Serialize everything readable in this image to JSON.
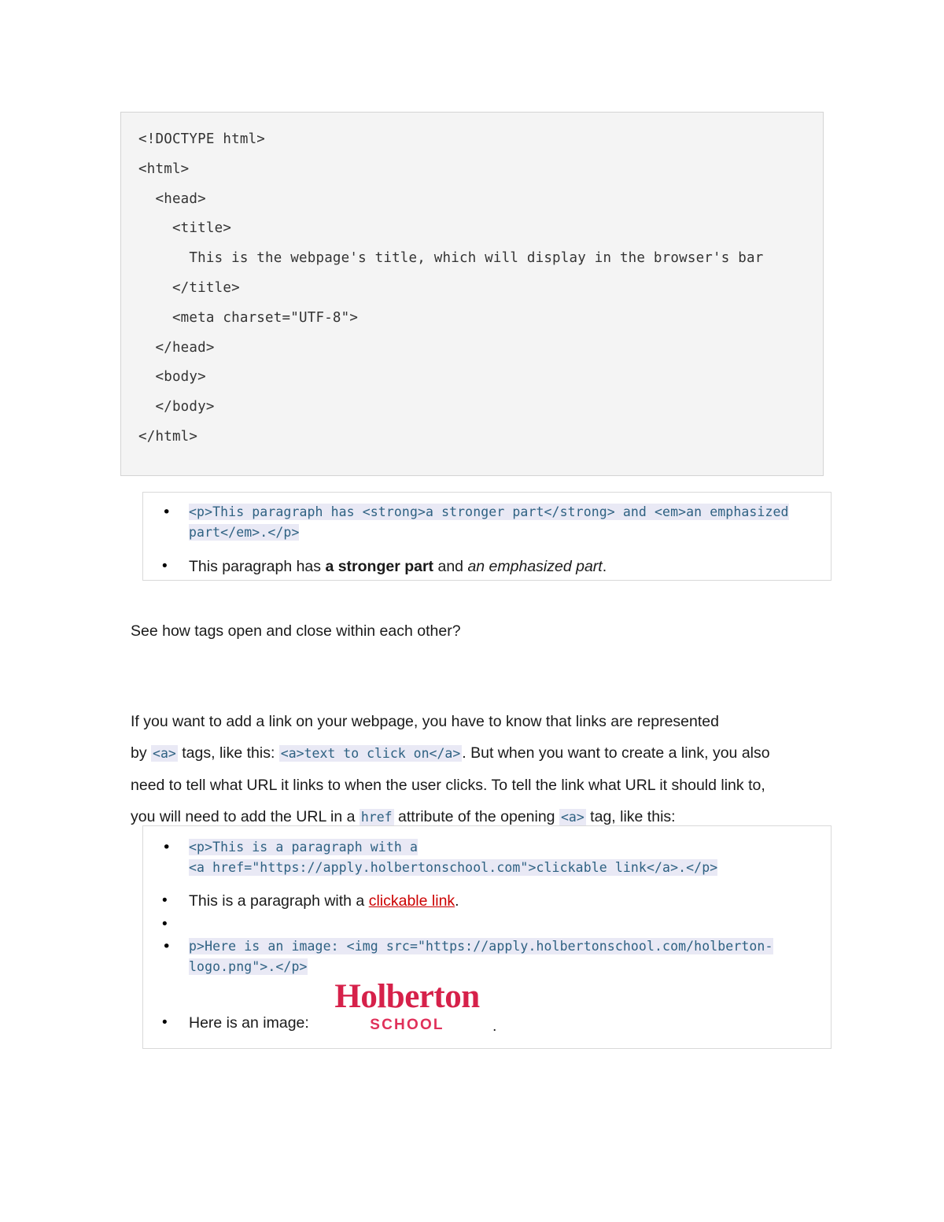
{
  "document": {
    "code_block": {
      "name": "html-skeleton-code",
      "lines": [
        "<!DOCTYPE html>",
        "<html>",
        "  <head>",
        "    <title>",
        "      This is the webpage's title, which will display in the browser's bar",
        "    </title>",
        "    <meta charset=\"UTF-8\">",
        "  </head>",
        "  <body>",
        "",
        "  </body>",
        "</html>"
      ]
    },
    "example_box_1": {
      "code_item": "<p>This paragraph has <strong>a stronger part</strong> and <em>an emphasized part</em>.</p>",
      "rendered_item": {
        "prefix": "This paragraph has ",
        "strong": "a stronger part",
        "middle": " and ",
        "em": "an emphasized part",
        "suffix": "."
      }
    },
    "paragraphs": {
      "see_how": "See how tags open and close within each other?",
      "links_intro_1": "If you want to add a link on your webpage, you have to know that links are represented",
      "links_intro_2_a": "by ",
      "links_intro_2_code1": "<a>",
      "links_intro_2_b": " tags, like this: ",
      "links_intro_2_code2": "<a>text to click on</a>",
      "links_intro_2_c": ". But when you want to create a link, you also",
      "links_intro_3": "need to tell what URL it links to when the user clicks. To tell the link what URL it should link to,",
      "links_intro_4_a": "you will need to add the URL in a ",
      "links_intro_4_code1": "href",
      "links_intro_4_b": " attribute of the opening ",
      "links_intro_4_code2": "<a>",
      "links_intro_4_c": " tag, like this:"
    },
    "example_box_2": {
      "link_code_line1": "<p>This is a paragraph with a",
      "link_code_line2": "<a href=\"https://apply.holbertonschool.com\">clickable link</a>.</p>",
      "link_rendered": {
        "prefix": "This is a paragraph with a ",
        "link_text": "clickable link",
        "suffix": "."
      },
      "empty_bullet": "",
      "image_code_line1": "p>Here is an image: <img src=\"https://apply.holbertonschool.com/holberton-",
      "image_code_line2": "logo.png\">.</p>",
      "image_rendered_prefix": "Here is an image:",
      "image_rendered_suffix": ".",
      "logo": {
        "word": "Holberton",
        "sub": "SCHOOL"
      }
    }
  },
  "colors": {
    "code_text": "#2e6182",
    "code_highlight_bg": "#e9e9f5",
    "code_block_bg": "#f4f4f4",
    "link_red": "#cc0000",
    "logo_red": "#d6214a",
    "body_text": "#1a1a1a"
  }
}
